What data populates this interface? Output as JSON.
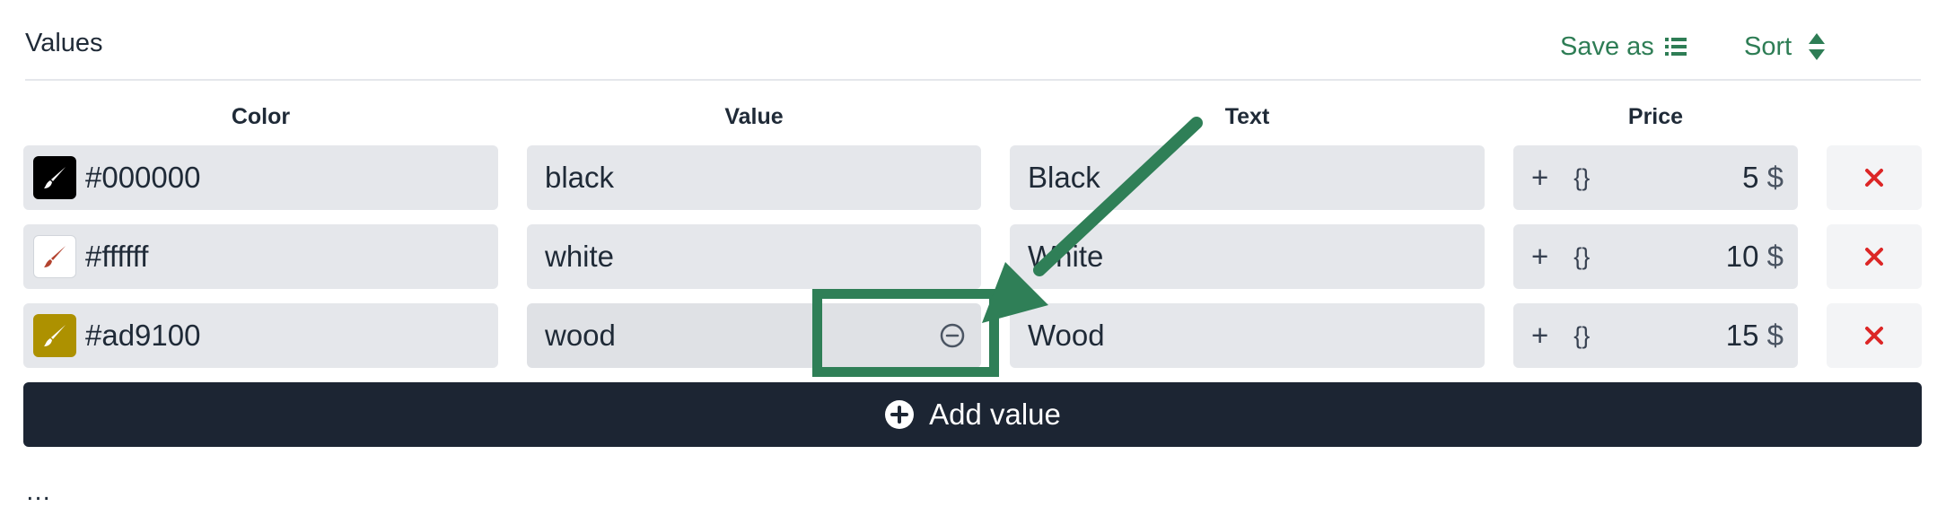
{
  "section_title": "Values",
  "header": {
    "save_as_label": "Save as",
    "sort_label": "Sort"
  },
  "columns": {
    "color": "Color",
    "value": "Value",
    "text": "Text",
    "price": "Price"
  },
  "rows": [
    {
      "color": "#000000",
      "swatch": "#000000",
      "brush": "#ffffff",
      "value": "black",
      "text": "Black",
      "price": "5",
      "currency": "$"
    },
    {
      "color": "#ffffff",
      "swatch": "#ffffff",
      "brush": "#b3432f",
      "value": "white",
      "text": "White",
      "price": "10",
      "currency": "$"
    },
    {
      "color": "#ad9100",
      "swatch": "#ad9100",
      "brush": "#ffffff",
      "value": "wood",
      "text": "Wood",
      "price": "15",
      "currency": "$"
    }
  ],
  "price_ops": {
    "add_symbol": "+",
    "formula_symbol": "{}"
  },
  "add_button_label": "Add value",
  "colors": {
    "accent_green": "#2e7d55",
    "delete_red": "#dc2626",
    "dark_button": "#1c2533",
    "field_bg": "#e5e7eb"
  },
  "icons": [
    "list-icon",
    "sort-icon",
    "paintbrush-icon",
    "remove-circle-icon",
    "delete-x-icon",
    "plus-circle-icon"
  ]
}
